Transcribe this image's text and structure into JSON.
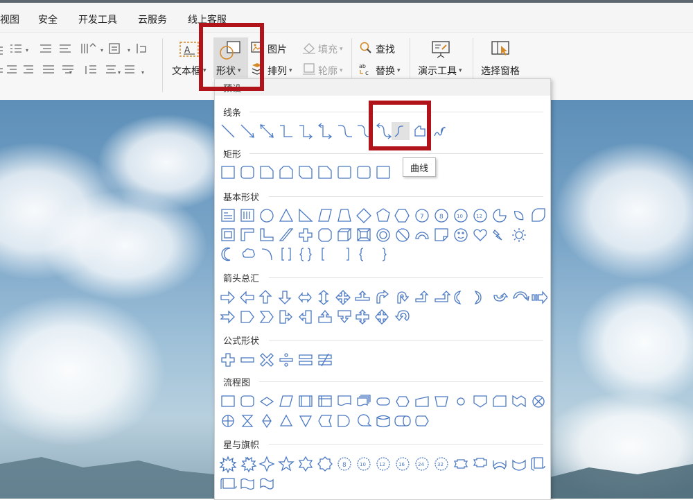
{
  "menu": [
    "视图",
    "安全",
    "开发工具",
    "云服务",
    "线上客服"
  ],
  "ribbon": {
    "textbox_label": "文本框",
    "shape_label": "形状",
    "picture_label": "图片",
    "fill_label": "填充",
    "arrange_label": "排列",
    "outline_label": "轮廓",
    "find_label": "查找",
    "replace_label": "替换",
    "present_tools_label": "演示工具",
    "selection_pane_label": "选择窗格"
  },
  "dropdown": {
    "header": "预设",
    "sections": [
      {
        "title": "线条"
      },
      {
        "title": "矩形"
      },
      {
        "title": "基本形状"
      },
      {
        "title": "箭头总汇"
      },
      {
        "title": "公式形状"
      },
      {
        "title": "流程图"
      },
      {
        "title": "星与旗帜"
      }
    ],
    "tooltip": "曲线",
    "selected_shape": "curve"
  },
  "colors": {
    "highlight_box": "#b0141a",
    "shape_stroke": "#4a78c2"
  }
}
